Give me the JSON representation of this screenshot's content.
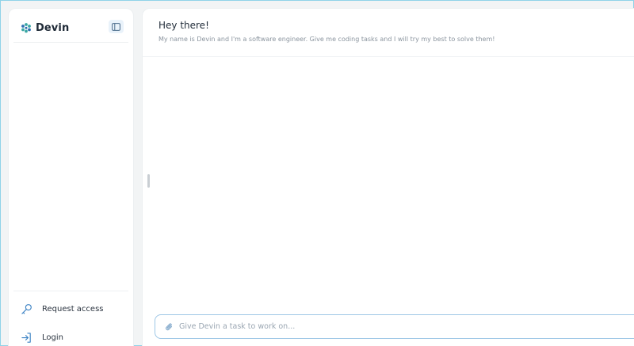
{
  "sidebar": {
    "brand_name": "Devin",
    "items": [
      {
        "label": "Request access",
        "icon": "key-icon"
      },
      {
        "label": "Login",
        "icon": "login-arrow-icon"
      }
    ]
  },
  "main": {
    "greeting_title": "Hey there!",
    "greeting_subtitle": "My name is Devin and I'm a software engineer. Give me coding tasks and I will try my best to solve them!",
    "task_input": {
      "placeholder": "Give Devin a task to work on...",
      "value": ""
    }
  },
  "colors": {
    "accent": "#3b82c4",
    "logo_teal": "#3aa7a3",
    "logo_blue": "#2f6fb0",
    "input_border": "#9ec7e6",
    "window_border": "#8fd3e8"
  }
}
